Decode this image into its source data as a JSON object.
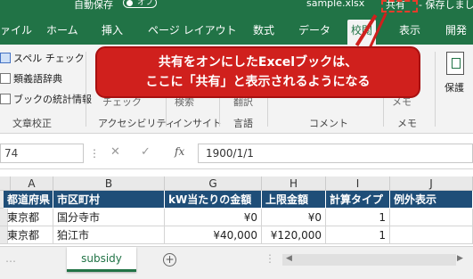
{
  "titlebar": {
    "autosave_label": "自動保存",
    "autosave_toggle": "オフ",
    "filename": "sample.xlsx",
    "share_label": "共有",
    "saved_status": "- 保存しまし"
  },
  "ribbon_tabs": [
    "ァイル",
    "ホーム",
    "挿入",
    "ページ レイアウト",
    "数式",
    "データ",
    "校閲",
    "表示",
    "開発"
  ],
  "active_tab": "校閲",
  "ribbon": {
    "proofing": {
      "items": [
        "スペル チェック",
        "類義語辞典",
        "ブックの統計情報"
      ],
      "label": "文章校正"
    },
    "accessibility": {
      "item": "チェック",
      "label": "アクセシビリティ"
    },
    "insights": {
      "item": "検索",
      "label": "インサイト"
    },
    "language": {
      "item": "翻訳",
      "label": "言語"
    },
    "comments": {
      "label": "コメント"
    },
    "notes": {
      "item": "メモ",
      "label": "メモ"
    },
    "protect": {
      "label": "保護"
    }
  },
  "callout": {
    "line1": "共有をオンにしたExcelブックは、",
    "line2": "ここに「共有」と表示されるようになる"
  },
  "formula_bar": {
    "name_box": "74",
    "fx": "fx",
    "cancel": "✕",
    "enter": "✓",
    "value": "1900/1/1"
  },
  "columns": [
    "A",
    "B",
    "G",
    "H",
    "I",
    "J"
  ],
  "table": {
    "headers": [
      "都道府県",
      "市区町村",
      "kW当たりの金額",
      "上限金額",
      "計算タイプ",
      "例外表示"
    ],
    "rows": [
      [
        "東京都",
        "国分寺市",
        "¥0",
        "¥0",
        "1",
        ""
      ],
      [
        "東京都",
        "狛江市",
        "¥40,000",
        "¥120,000",
        "1",
        ""
      ]
    ]
  },
  "sheets": {
    "tab": "subsidy",
    "add": "+",
    "nav_dots": "…"
  },
  "colors": {
    "brand_green": "#217346",
    "callout_red": "#d0201d",
    "header_blue": "#1f4e78"
  }
}
